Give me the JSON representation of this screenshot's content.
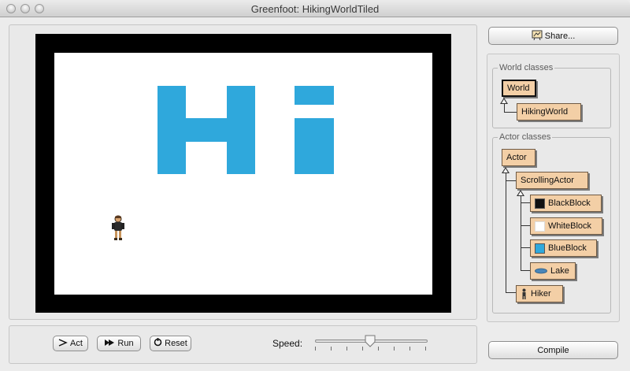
{
  "window": {
    "title": "Greenfoot: HikingWorldTiled"
  },
  "world": {
    "text": "Hi",
    "letter_color": "#2fa8dc",
    "border_color": "#000000",
    "background_color": "#ffffff"
  },
  "controls": {
    "act_label": "Act",
    "run_label": "Run",
    "reset_label": "Reset",
    "speed_label": "Speed:",
    "speed_value": 0.5
  },
  "sidebar": {
    "share_label": "Share...",
    "compile_label": "Compile",
    "world_classes": {
      "title": "World classes",
      "items": [
        "World",
        "HikingWorld"
      ]
    },
    "actor_classes": {
      "title": "Actor classes",
      "items": [
        "Actor",
        "ScrollingActor",
        "BlackBlock",
        "WhiteBlock",
        "BlueBlock",
        "Lake",
        "Hiker"
      ]
    }
  },
  "colors": {
    "class_box": "#f3cfa6",
    "black_block": "#111111",
    "white_block": "#ffffff",
    "blue_block": "#2fa8dc",
    "lake": "#4a86b8"
  },
  "icons": [
    "share-icon",
    "act-icon",
    "run-icon",
    "reset-icon",
    "hiker-icon",
    "lake-icon"
  ]
}
